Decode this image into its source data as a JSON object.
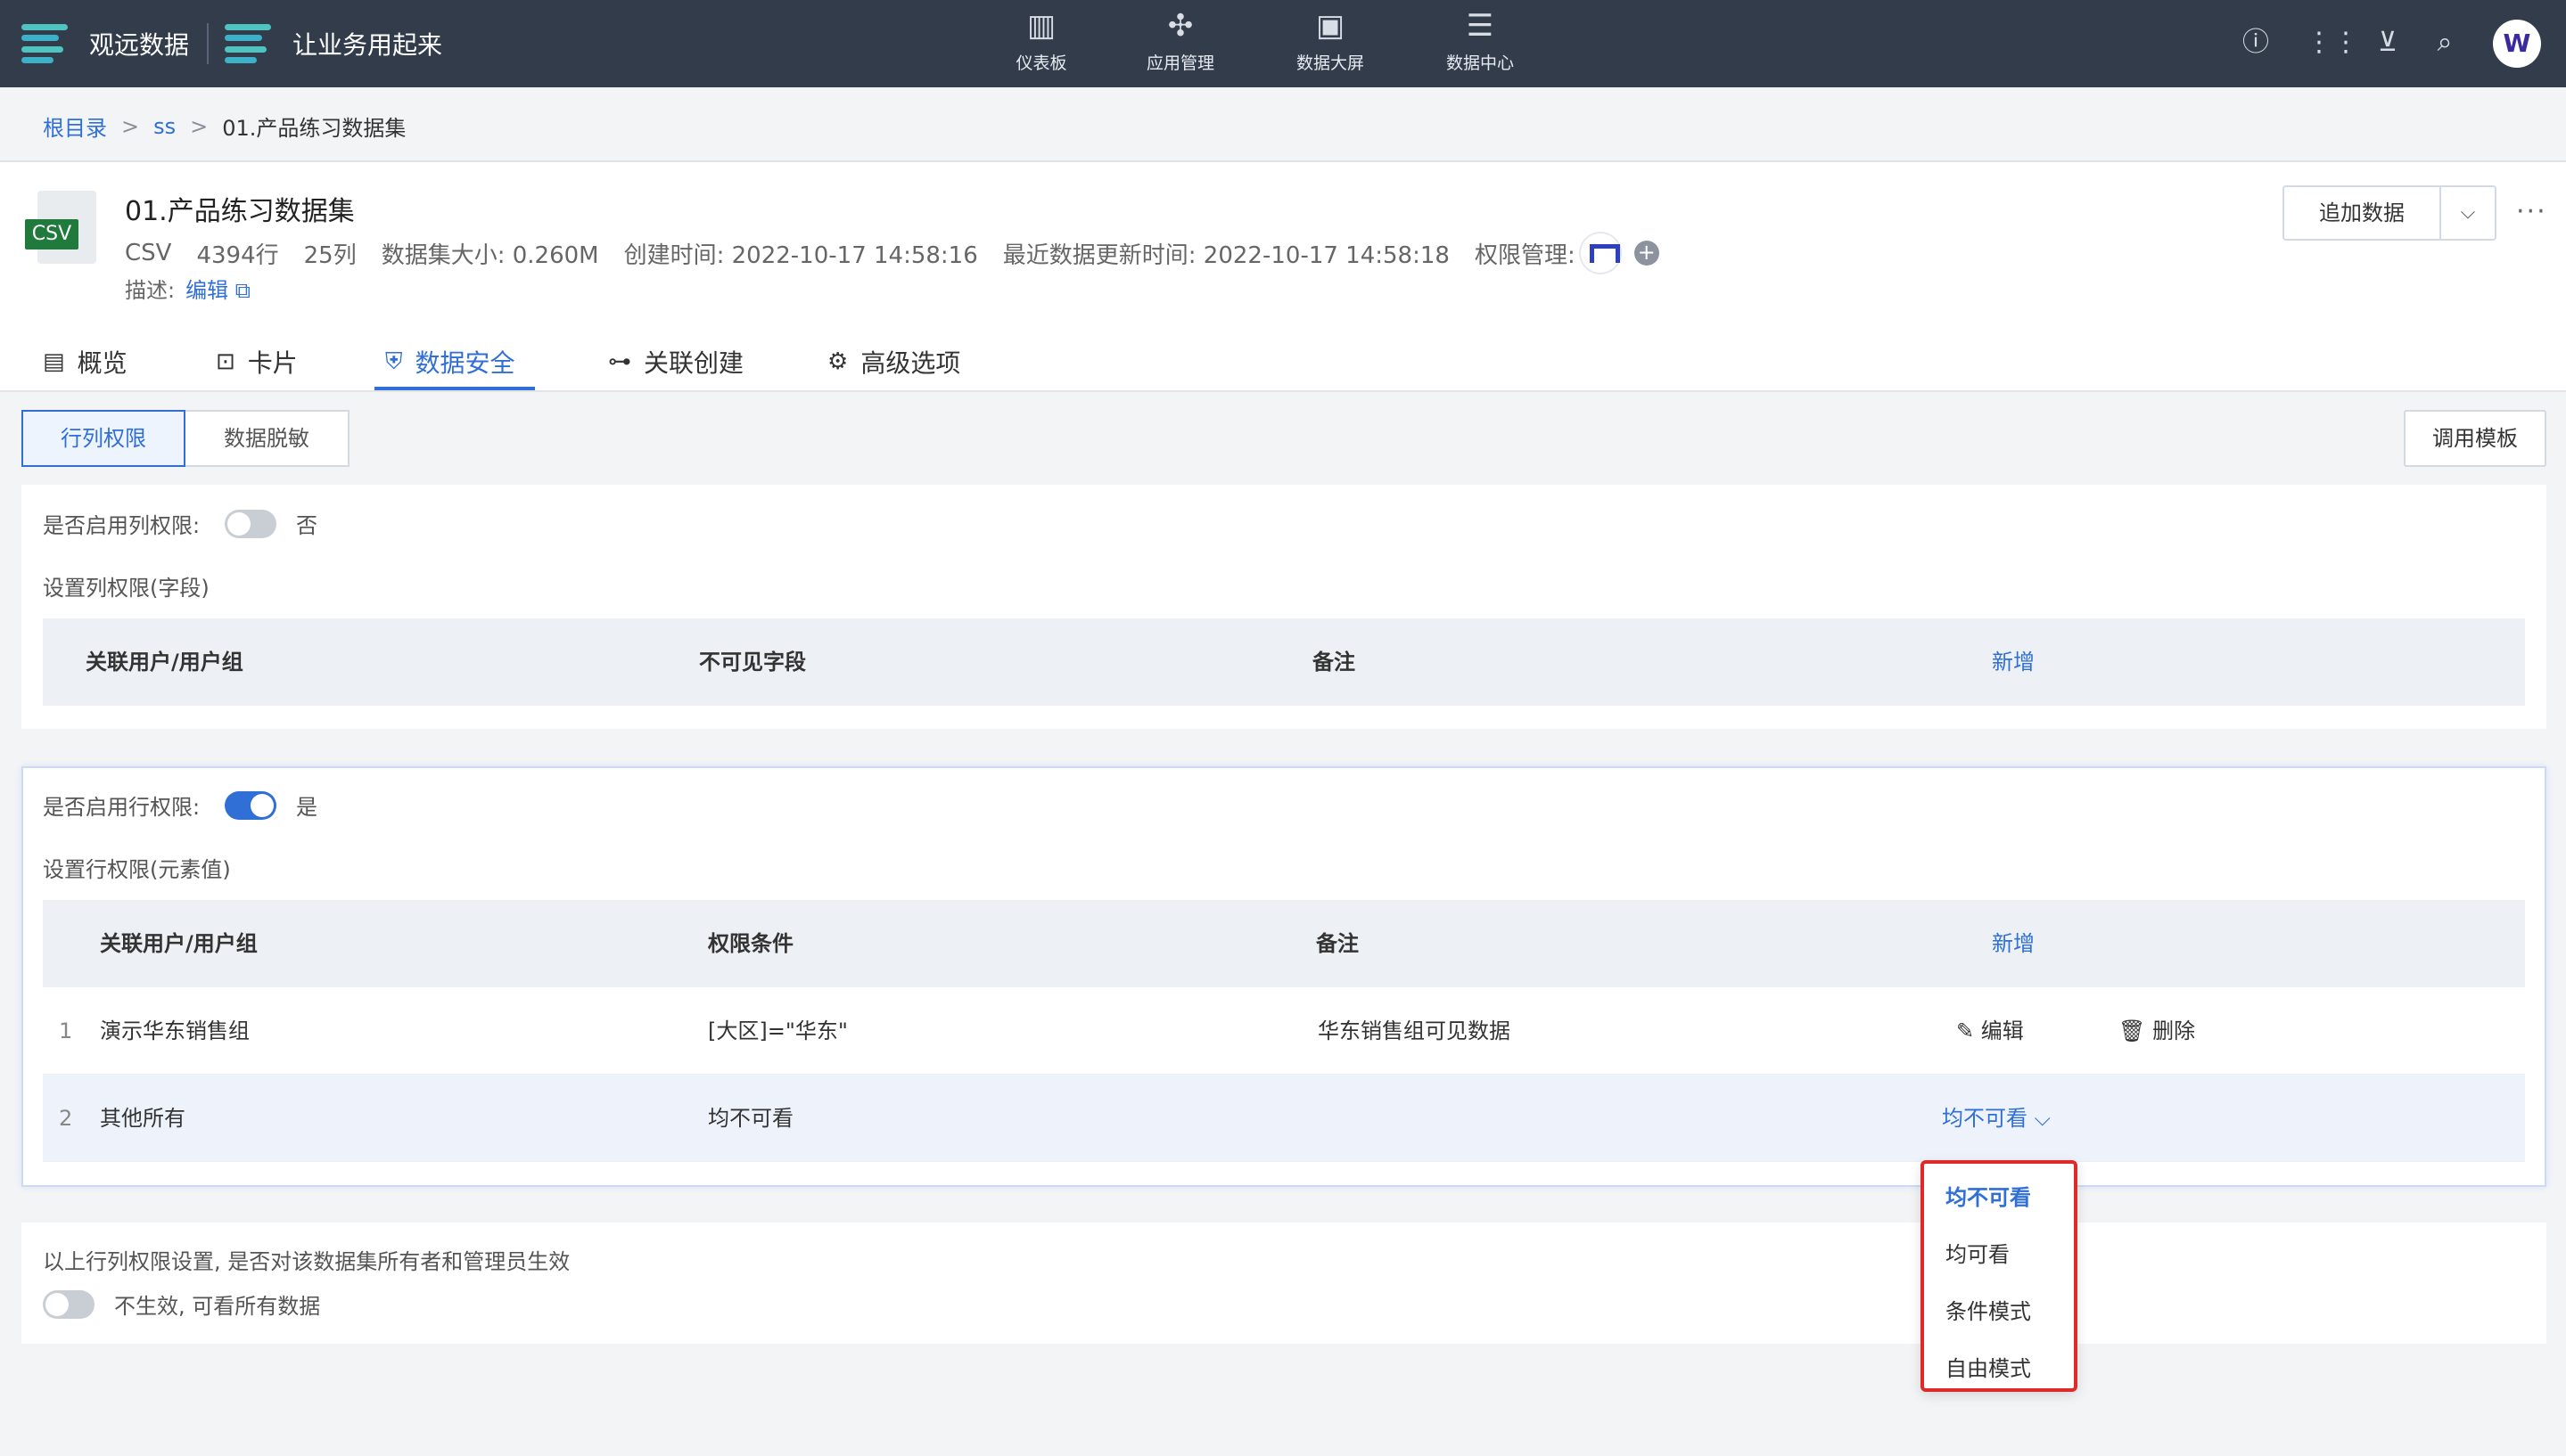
{
  "topbar": {
    "brand1": "观远数据",
    "brand2": "让业务用起来",
    "nav": [
      {
        "label": "仪表板",
        "icon": "bar-chart-icon"
      },
      {
        "label": "应用管理",
        "icon": "apps-icon"
      },
      {
        "label": "数据大屏",
        "icon": "screen-icon"
      },
      {
        "label": "数据中心",
        "icon": "database-icon"
      }
    ],
    "avatar": "W"
  },
  "breadcrumb": {
    "root": "根目录",
    "sep": ">",
    "folder": "ss",
    "current": "01.产品练习数据集"
  },
  "dataset": {
    "icon_label": "CSV",
    "title": "01.产品练习数据集",
    "type": "CSV",
    "rows": "4394行",
    "cols": "25列",
    "size": "数据集大小: 0.260M",
    "created": "创建时间: 2022-10-17 14:58:16",
    "updated": "最近数据更新时间: 2022-10-17 14:58:18",
    "perm_label": "权限管理:",
    "desc_label": "描述:",
    "desc_edit": "编辑"
  },
  "actions": {
    "add_data": "追加数据",
    "more": "···"
  },
  "tabs": [
    "概览",
    "卡片",
    "数据安全",
    "关联创建",
    "高级选项"
  ],
  "sub_tabs": {
    "row_col": "行列权限",
    "masking": "数据脱敏",
    "template": "调用模板"
  },
  "col_perm": {
    "enable_label": "是否启用列权限:",
    "enable_value": "否",
    "section_title": "设置列权限(字段)",
    "headers": [
      "关联用户/用户组",
      "不可见字段",
      "备注"
    ],
    "add": "新增"
  },
  "row_perm": {
    "enable_label": "是否启用行权限:",
    "enable_value": "是",
    "section_title": "设置行权限(元素值)",
    "headers": [
      "关联用户/用户组",
      "权限条件",
      "备注"
    ],
    "add": "新增",
    "rows": [
      {
        "idx": "1",
        "user": "演示华东销售组",
        "cond": "[大区]=\"华东\"",
        "note": "华东销售组可见数据",
        "edit": "编辑",
        "delete": "删除"
      },
      {
        "idx": "2",
        "user": "其他所有",
        "cond": "均不可看",
        "note": "",
        "select": "均不可看"
      }
    ]
  },
  "owner_setting": {
    "question": "以上行列权限设置, 是否对该数据集所有者和管理员生效",
    "value": "不生效, 可看所有数据"
  },
  "dropdown": [
    "均不可看",
    "均可看",
    "条件模式",
    "自由模式"
  ],
  "colors": {
    "accent": "#2f6fd6",
    "topbar": "#323c4b",
    "highlight": "#e02a2a"
  }
}
